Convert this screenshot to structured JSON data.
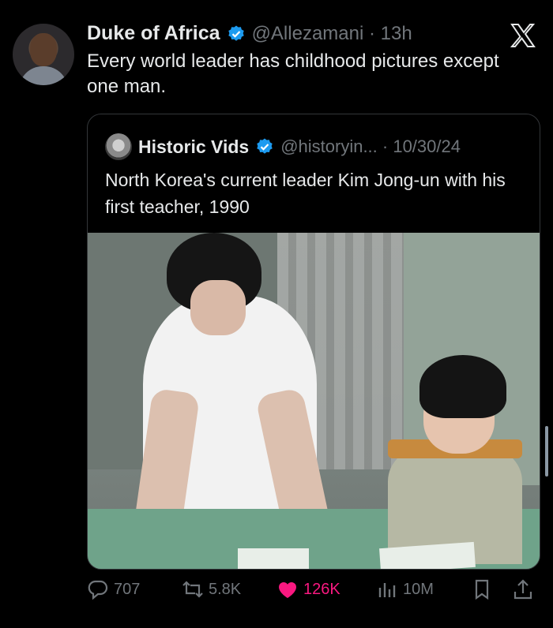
{
  "tweet": {
    "author_name": "Duke of Africa",
    "handle_time": "@Allezamani · 13h",
    "text": "Every world leader has childhood pictures except one man.",
    "brand_color": "#1d9bf0"
  },
  "quote": {
    "author_name": "Historic Vids",
    "handle_time": "@historyin... · 10/30/24",
    "text": "North Korea's current leader Kim Jong-un with his first teacher, 1990"
  },
  "actions": {
    "replies": "707",
    "reposts": "5.8K",
    "likes": "126K",
    "views": "10M"
  },
  "icons": [
    "verified-badge-icon",
    "x-logo-icon",
    "reply-icon",
    "repost-icon",
    "heart-icon",
    "views-icon",
    "bookmark-icon",
    "share-icon"
  ]
}
